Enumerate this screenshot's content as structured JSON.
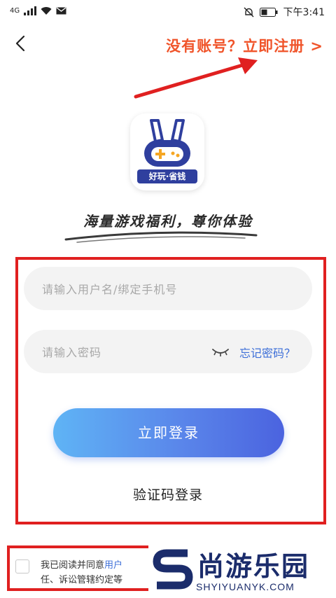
{
  "status_bar": {
    "network": "4G",
    "time": "下午3:41"
  },
  "header": {
    "register_link": "没有账号？立即注册 >"
  },
  "logo": {
    "caption": "好玩·省钱"
  },
  "slogan": "海量游戏福利，尊你体验",
  "form": {
    "username_placeholder": "请输入用户名/绑定手机号",
    "password_placeholder": "请输入密码",
    "forgot_password": "忘记密码？",
    "login_button": "立即登录",
    "code_login": "验证码登录"
  },
  "agreement": {
    "line1_prefix": "我已阅读并同意",
    "line1_link": "用户",
    "line2": "任、诉讼管辖约定等"
  },
  "watermark": {
    "name_cn": "尚游乐园",
    "name_en": "SHYIYUANYK.COM"
  },
  "colors": {
    "accent_orange": "#f0542a",
    "highlight_red": "#e02020",
    "link_blue": "#3d6fd8",
    "brand_navy": "#1b2c6b"
  }
}
